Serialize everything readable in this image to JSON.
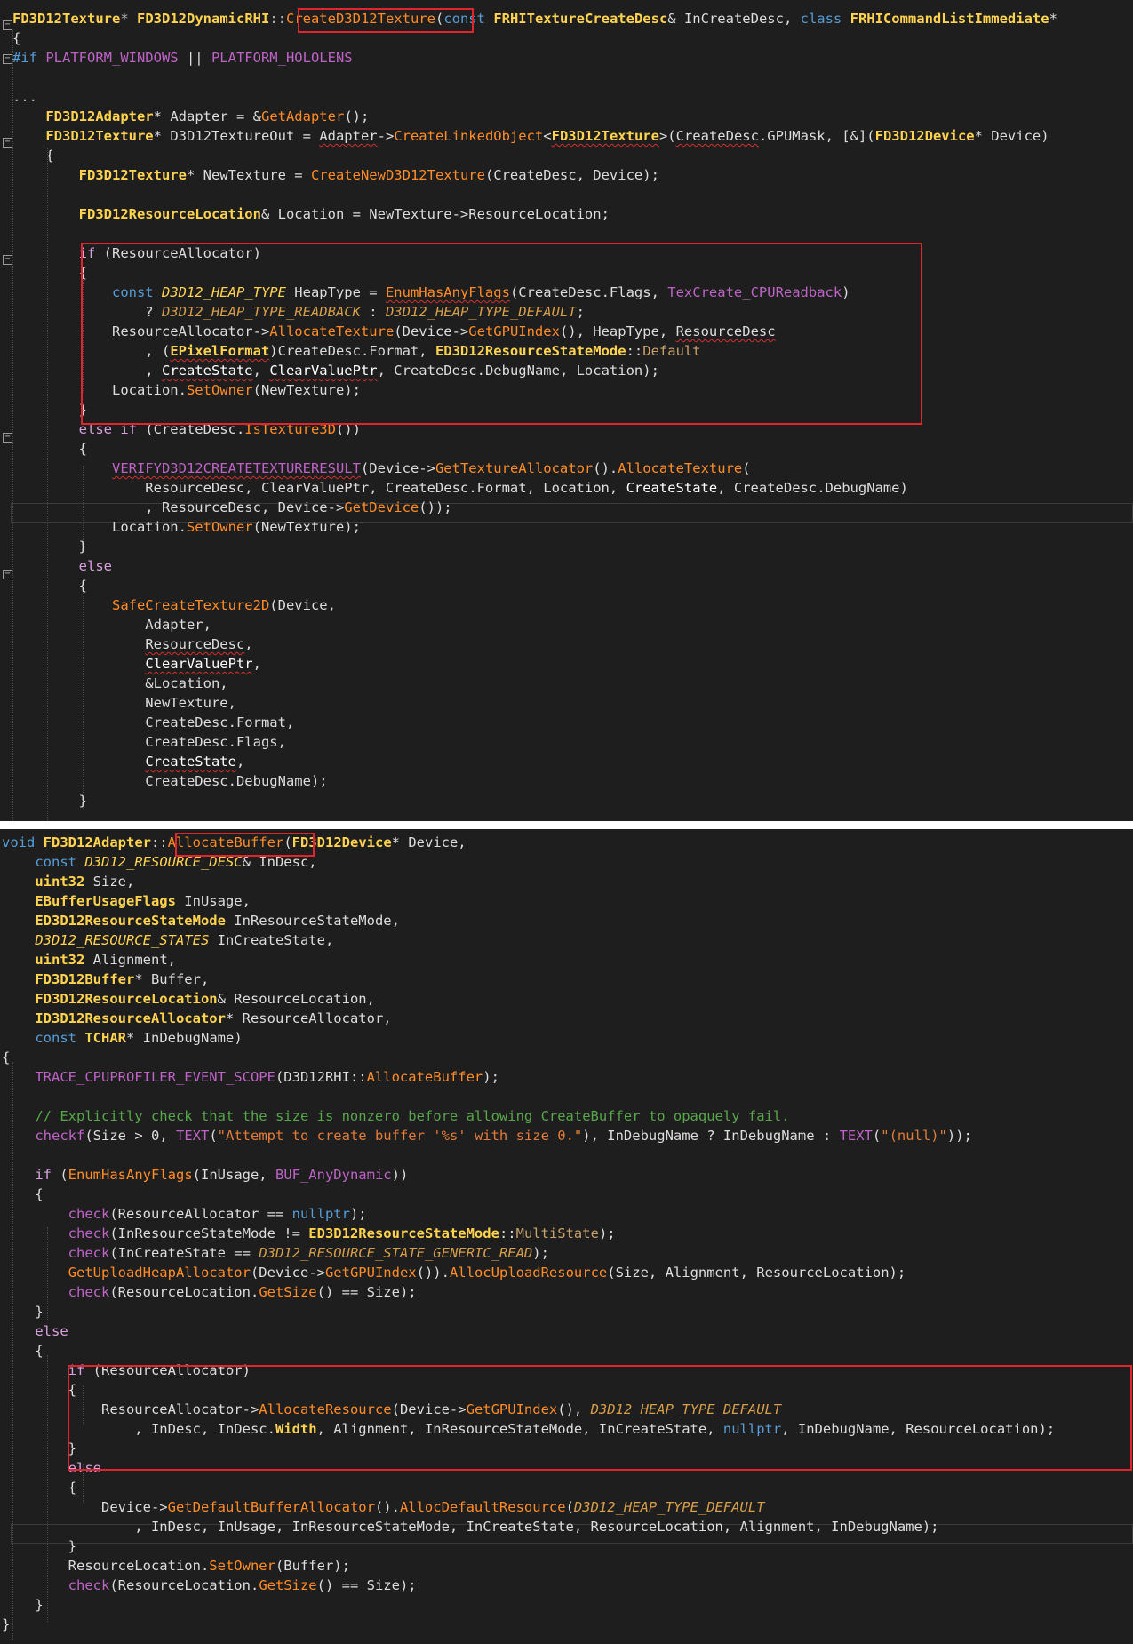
{
  "panel_top": {
    "lines": [
      [
        {
          "t": "FD3D12Texture",
          "c": "ty"
        },
        {
          "t": "* ",
          "c": "op"
        },
        {
          "t": "FD3D12DynamicRHI",
          "c": "ty"
        },
        {
          "t": "::",
          "c": "op"
        },
        {
          "t": "CreateD3D12Texture",
          "c": "fn"
        },
        {
          "t": "("
        },
        {
          "t": "const ",
          "c": "kw"
        },
        {
          "t": "FRHITextureCreateDesc",
          "c": "ty"
        },
        {
          "t": "& "
        },
        {
          "t": "InCreateDesc"
        },
        {
          "t": ", "
        },
        {
          "t": "class ",
          "c": "kw"
        },
        {
          "t": "FRHICommandListImmediate",
          "c": "ty"
        },
        {
          "t": "*"
        }
      ],
      [
        {
          "t": "{"
        }
      ],
      [
        {
          "t": "#if ",
          "c": "kw"
        },
        {
          "t": "PLATFORM_WINDOWS",
          "c": "mac"
        },
        {
          "t": " || "
        },
        {
          "t": "PLATFORM_HOLOLENS",
          "c": "mac"
        }
      ],
      [],
      [
        {
          "t": "...",
          "c": "op"
        }
      ],
      [
        {
          "t": "    "
        },
        {
          "t": "FD3D12Adapter",
          "c": "ty"
        },
        {
          "t": "* "
        },
        {
          "t": "Adapter"
        },
        {
          "t": " = &"
        },
        {
          "t": "GetAdapter",
          "c": "fn"
        },
        {
          "t": "();"
        }
      ],
      [
        {
          "t": "    "
        },
        {
          "t": "FD3D12Texture",
          "c": "ty"
        },
        {
          "t": "* "
        },
        {
          "t": "D3D12TextureOut"
        },
        {
          "t": " = "
        },
        {
          "t": "Adapter",
          "c": "wv"
        },
        {
          "t": "->"
        },
        {
          "t": "CreateLinkedObject",
          "c": "fn"
        },
        {
          "t": "<"
        },
        {
          "t": "FD3D12Texture",
          "c": "ty wv"
        },
        {
          "t": ">("
        },
        {
          "t": "CreateDesc",
          "c": "wv"
        },
        {
          "t": ".GPUMask, [&]("
        },
        {
          "t": "FD3D12Device",
          "c": "ty"
        },
        {
          "t": "* Device)"
        }
      ],
      [
        {
          "t": "    {"
        }
      ],
      [
        {
          "t": "        "
        },
        {
          "t": "FD3D12Texture",
          "c": "ty"
        },
        {
          "t": "* NewTexture = "
        },
        {
          "t": "CreateNewD3D12Texture",
          "c": "fn"
        },
        {
          "t": "(CreateDesc, Device);"
        }
      ],
      [],
      [
        {
          "t": "        "
        },
        {
          "t": "FD3D12ResourceLocation",
          "c": "ty"
        },
        {
          "t": "& Location = NewTexture->ResourceLocation;"
        }
      ],
      [],
      [
        {
          "t": "        "
        },
        {
          "t": "if ",
          "c": "ctl"
        },
        {
          "t": "(ResourceAllocator)"
        }
      ],
      [
        {
          "t": "        {"
        }
      ],
      [
        {
          "t": "            "
        },
        {
          "t": "const ",
          "c": "kw"
        },
        {
          "t": "D3D12_HEAP_TYPE",
          "c": "eny"
        },
        {
          "t": " HeapType = "
        },
        {
          "t": "EnumHasAnyFlags",
          "c": "fn wv"
        },
        {
          "t": "(CreateDesc.Flags, "
        },
        {
          "t": "TexCreate_CPUReadback",
          "c": "mac"
        },
        {
          "t": ")"
        }
      ],
      [
        {
          "t": "                ? "
        },
        {
          "t": "D3D12_HEAP_TYPE_READBACK",
          "c": "em"
        },
        {
          "t": " : "
        },
        {
          "t": "D3D12_HEAP_TYPE_DEFAULT",
          "c": "em"
        },
        {
          "t": ";"
        }
      ],
      [
        {
          "t": "            ResourceAllocator->"
        },
        {
          "t": "AllocateTexture",
          "c": "fn"
        },
        {
          "t": "(Device->"
        },
        {
          "t": "GetGPUIndex",
          "c": "fn"
        },
        {
          "t": "(), HeapType, "
        },
        {
          "t": "ResourceDesc",
          "c": "wv"
        }
      ],
      [
        {
          "t": "                , ("
        },
        {
          "t": "EPixelFormat",
          "c": "ty wv"
        },
        {
          "t": ")CreateDesc.Format, "
        },
        {
          "t": "ED3D12ResourceStateMode",
          "c": "ty"
        },
        {
          "t": "::"
        },
        {
          "t": "Default",
          "c": "enm"
        }
      ],
      [
        {
          "t": "                , "
        },
        {
          "t": "CreateState",
          "c": "wb wv"
        },
        {
          "t": ", "
        },
        {
          "t": "ClearValuePtr",
          "c": "wb wv"
        },
        {
          "t": ", CreateDesc.DebugName, Location);"
        }
      ],
      [
        {
          "t": "            Location."
        },
        {
          "t": "SetOwner",
          "c": "fn"
        },
        {
          "t": "(NewTexture);"
        }
      ],
      [
        {
          "t": "        }"
        }
      ],
      [
        {
          "t": "        "
        },
        {
          "t": "else if ",
          "c": "ctl"
        },
        {
          "t": "(CreateDesc."
        },
        {
          "t": "IsTexture3D",
          "c": "fn"
        },
        {
          "t": "())"
        }
      ],
      [
        {
          "t": "        {"
        }
      ],
      [
        {
          "t": "            "
        },
        {
          "t": "VERIFYD3D12CREATETEXTURERESULT",
          "c": "mac wv"
        },
        {
          "t": "(Device->"
        },
        {
          "t": "GetTextureAllocator",
          "c": "fn"
        },
        {
          "t": "()."
        },
        {
          "t": "AllocateTexture",
          "c": "fn"
        },
        {
          "t": "("
        }
      ],
      [
        {
          "t": "                ResourceDesc, ClearValuePtr, CreateDesc.Format, Location, "
        },
        {
          "t": "CreateState",
          "c": "wb"
        },
        {
          "t": ", CreateDesc.DebugName)"
        }
      ],
      [
        {
          "t": "                , ResourceDesc, Device->"
        },
        {
          "t": "GetDevice",
          "c": "fn"
        },
        {
          "t": "());"
        }
      ],
      [
        {
          "t": "            Location."
        },
        {
          "t": "SetOwner",
          "c": "fn"
        },
        {
          "t": "(NewTexture);"
        }
      ],
      [
        {
          "t": "        }"
        }
      ],
      [
        {
          "t": "        "
        },
        {
          "t": "else",
          "c": "ctl"
        }
      ],
      [
        {
          "t": "        {"
        }
      ],
      [
        {
          "t": "            "
        },
        {
          "t": "SafeCreateTexture2D",
          "c": "fn"
        },
        {
          "t": "(Device,"
        }
      ],
      [
        {
          "t": "                Adapter,"
        }
      ],
      [
        {
          "t": "                "
        },
        {
          "t": "ResourceDesc",
          "c": "wv"
        },
        {
          "t": ","
        }
      ],
      [
        {
          "t": "                "
        },
        {
          "t": "ClearValuePtr",
          "c": "wb wv"
        },
        {
          "t": ","
        }
      ],
      [
        {
          "t": "                &Location,"
        }
      ],
      [
        {
          "t": "                NewTexture,"
        }
      ],
      [
        {
          "t": "                CreateDesc.Format,"
        }
      ],
      [
        {
          "t": "                CreateDesc.Flags,"
        }
      ],
      [
        {
          "t": "                "
        },
        {
          "t": "CreateState",
          "c": "wb wv"
        },
        {
          "t": ","
        }
      ],
      [
        {
          "t": "                CreateDesc.DebugName);"
        }
      ],
      [
        {
          "t": "        }"
        }
      ]
    ]
  },
  "panel_bottom": {
    "lines": [
      [
        {
          "t": "void ",
          "c": "kw"
        },
        {
          "t": "FD3D12Adapter",
          "c": "ty"
        },
        {
          "t": "::"
        },
        {
          "t": "AllocateBuffer",
          "c": "fn"
        },
        {
          "t": "("
        },
        {
          "t": "FD3D12Device",
          "c": "ty"
        },
        {
          "t": "* Device,"
        }
      ],
      [
        {
          "t": "    "
        },
        {
          "t": "const ",
          "c": "kw"
        },
        {
          "t": "D3D12_RESOURCE_DESC",
          "c": "eny"
        },
        {
          "t": "& InDesc,"
        }
      ],
      [
        {
          "t": "    "
        },
        {
          "t": "uint32",
          "c": "ty"
        },
        {
          "t": " Size,"
        }
      ],
      [
        {
          "t": "    "
        },
        {
          "t": "EBufferUsageFlags",
          "c": "ty"
        },
        {
          "t": " InUsage,"
        }
      ],
      [
        {
          "t": "    "
        },
        {
          "t": "ED3D12ResourceStateMode",
          "c": "ty"
        },
        {
          "t": " InResourceStateMode,"
        }
      ],
      [
        {
          "t": "    "
        },
        {
          "t": "D3D12_RESOURCE_STATES",
          "c": "eny"
        },
        {
          "t": " InCreateState,"
        }
      ],
      [
        {
          "t": "    "
        },
        {
          "t": "uint32",
          "c": "ty"
        },
        {
          "t": " Alignment,"
        }
      ],
      [
        {
          "t": "    "
        },
        {
          "t": "FD3D12Buffer",
          "c": "ty"
        },
        {
          "t": "* Buffer,"
        }
      ],
      [
        {
          "t": "    "
        },
        {
          "t": "FD3D12ResourceLocation",
          "c": "ty"
        },
        {
          "t": "& ResourceLocation,"
        }
      ],
      [
        {
          "t": "    "
        },
        {
          "t": "ID3D12ResourceAllocator",
          "c": "ty"
        },
        {
          "t": "* ResourceAllocator,"
        }
      ],
      [
        {
          "t": "    "
        },
        {
          "t": "const ",
          "c": "kw"
        },
        {
          "t": "TCHAR",
          "c": "ty"
        },
        {
          "t": "* InDebugName)"
        }
      ],
      [
        {
          "t": "{"
        }
      ],
      [
        {
          "t": "    "
        },
        {
          "t": "TRACE_CPUPROFILER_EVENT_SCOPE",
          "c": "mac"
        },
        {
          "t": "(D3D12RHI::"
        },
        {
          "t": "AllocateBuffer",
          "c": "fn"
        },
        {
          "t": ");"
        }
      ],
      [],
      [
        {
          "t": "    // Explicitly check that the size is nonzero before allowing CreateBuffer to opaquely fail.",
          "c": "cm"
        }
      ],
      [
        {
          "t": "    "
        },
        {
          "t": "checkf",
          "c": "mac"
        },
        {
          "t": "(Size > 0, "
        },
        {
          "t": "TEXT",
          "c": "mac"
        },
        {
          "t": "("
        },
        {
          "t": "\"Attempt to create buffer '%s' with size 0.\"",
          "c": "str"
        },
        {
          "t": "), InDebugName ? InDebugName : "
        },
        {
          "t": "TEXT",
          "c": "mac"
        },
        {
          "t": "("
        },
        {
          "t": "\"(null)\"",
          "c": "str"
        },
        {
          "t": "));"
        }
      ],
      [],
      [
        {
          "t": "    "
        },
        {
          "t": "if ",
          "c": "ctl"
        },
        {
          "t": "("
        },
        {
          "t": "EnumHasAnyFlags",
          "c": "fn"
        },
        {
          "t": "(InUsage, "
        },
        {
          "t": "BUF_AnyDynamic",
          "c": "mac"
        },
        {
          "t": "))"
        }
      ],
      [
        {
          "t": "    {"
        }
      ],
      [
        {
          "t": "        "
        },
        {
          "t": "check",
          "c": "mac"
        },
        {
          "t": "(ResourceAllocator == "
        },
        {
          "t": "nullptr",
          "c": "kw"
        },
        {
          "t": ");"
        }
      ],
      [
        {
          "t": "        "
        },
        {
          "t": "check",
          "c": "mac"
        },
        {
          "t": "(InResourceStateMode != "
        },
        {
          "t": "ED3D12ResourceStateMode",
          "c": "ty"
        },
        {
          "t": "::"
        },
        {
          "t": "MultiState",
          "c": "enm"
        },
        {
          "t": ");"
        }
      ],
      [
        {
          "t": "        "
        },
        {
          "t": "check",
          "c": "mac"
        },
        {
          "t": "(InCreateState == "
        },
        {
          "t": "D3D12_RESOURCE_STATE_GENERIC_READ",
          "c": "em"
        },
        {
          "t": ");"
        }
      ],
      [
        {
          "t": "        "
        },
        {
          "t": "GetUploadHeapAllocator",
          "c": "fn"
        },
        {
          "t": "(Device->"
        },
        {
          "t": "GetGPUIndex",
          "c": "fn"
        },
        {
          "t": "())."
        },
        {
          "t": "AllocUploadResource",
          "c": "fn"
        },
        {
          "t": "(Size, Alignment, ResourceLocation);"
        }
      ],
      [
        {
          "t": "        "
        },
        {
          "t": "check",
          "c": "mac"
        },
        {
          "t": "(ResourceLocation."
        },
        {
          "t": "GetSize",
          "c": "fn"
        },
        {
          "t": "() == Size);"
        }
      ],
      [
        {
          "t": "    }"
        }
      ],
      [
        {
          "t": "    "
        },
        {
          "t": "else",
          "c": "ctl"
        }
      ],
      [
        {
          "t": "    {"
        }
      ],
      [
        {
          "t": "        "
        },
        {
          "t": "if ",
          "c": "ctl"
        },
        {
          "t": "(ResourceAllocator)"
        }
      ],
      [
        {
          "t": "        {"
        }
      ],
      [
        {
          "t": "            ResourceAllocator->"
        },
        {
          "t": "AllocateResource",
          "c": "fn"
        },
        {
          "t": "(Device->"
        },
        {
          "t": "GetGPUIndex",
          "c": "fn"
        },
        {
          "t": "(), "
        },
        {
          "t": "D3D12_HEAP_TYPE_DEFAULT",
          "c": "em"
        }
      ],
      [
        {
          "t": "                , InDesc, InDesc."
        },
        {
          "t": "Width",
          "c": "ty"
        },
        {
          "t": ", Alignment, InResourceStateMode, InCreateState, "
        },
        {
          "t": "nullptr",
          "c": "kw"
        },
        {
          "t": ", InDebugName, ResourceLocation);"
        }
      ],
      [
        {
          "t": "        }"
        }
      ],
      [
        {
          "t": "        "
        },
        {
          "t": "else",
          "c": "ctl"
        }
      ],
      [
        {
          "t": "        {"
        }
      ],
      [
        {
          "t": "            Device->"
        },
        {
          "t": "GetDefaultBufferAllocator",
          "c": "fn"
        },
        {
          "t": "()."
        },
        {
          "t": "AllocDefaultResource",
          "c": "fn"
        },
        {
          "t": "("
        },
        {
          "t": "D3D12_HEAP_TYPE_DEFAULT",
          "c": "em"
        }
      ],
      [
        {
          "t": "                , InDesc, InUsage, InResourceStateMode, InCreateState, ResourceLocation, Alignment, InDebugName);"
        }
      ],
      [
        {
          "t": "        }"
        }
      ],
      [
        {
          "t": "        ResourceLocation."
        },
        {
          "t": "SetOwner",
          "c": "fn"
        },
        {
          "t": "(Buffer);"
        }
      ],
      [
        {
          "t": "        "
        },
        {
          "t": "check",
          "c": "mac"
        },
        {
          "t": "(ResourceLocation."
        },
        {
          "t": "GetSize",
          "c": "fn"
        },
        {
          "t": "() == Size);"
        }
      ],
      [
        {
          "t": "    }"
        }
      ],
      [
        {
          "t": "}"
        }
      ]
    ]
  },
  "annotations": {
    "top_highlight_labels": [
      "CreateD3D12Texture",
      "if (ResourceAllocator) block"
    ],
    "bottom_highlight_labels": [
      "AllocateBuffer",
      "if (ResourceAllocator) block"
    ]
  },
  "colors": {
    "editor_background": "#1e1e1e",
    "highlight_border": "#e1252e",
    "type_yellow": "#ffd34f",
    "function_orange": "#ff8c26",
    "keyword_blue": "#569cd6",
    "control_pink": "#d8a0df",
    "macro_purple": "#bd63c5",
    "comment_green": "#57a64a"
  }
}
